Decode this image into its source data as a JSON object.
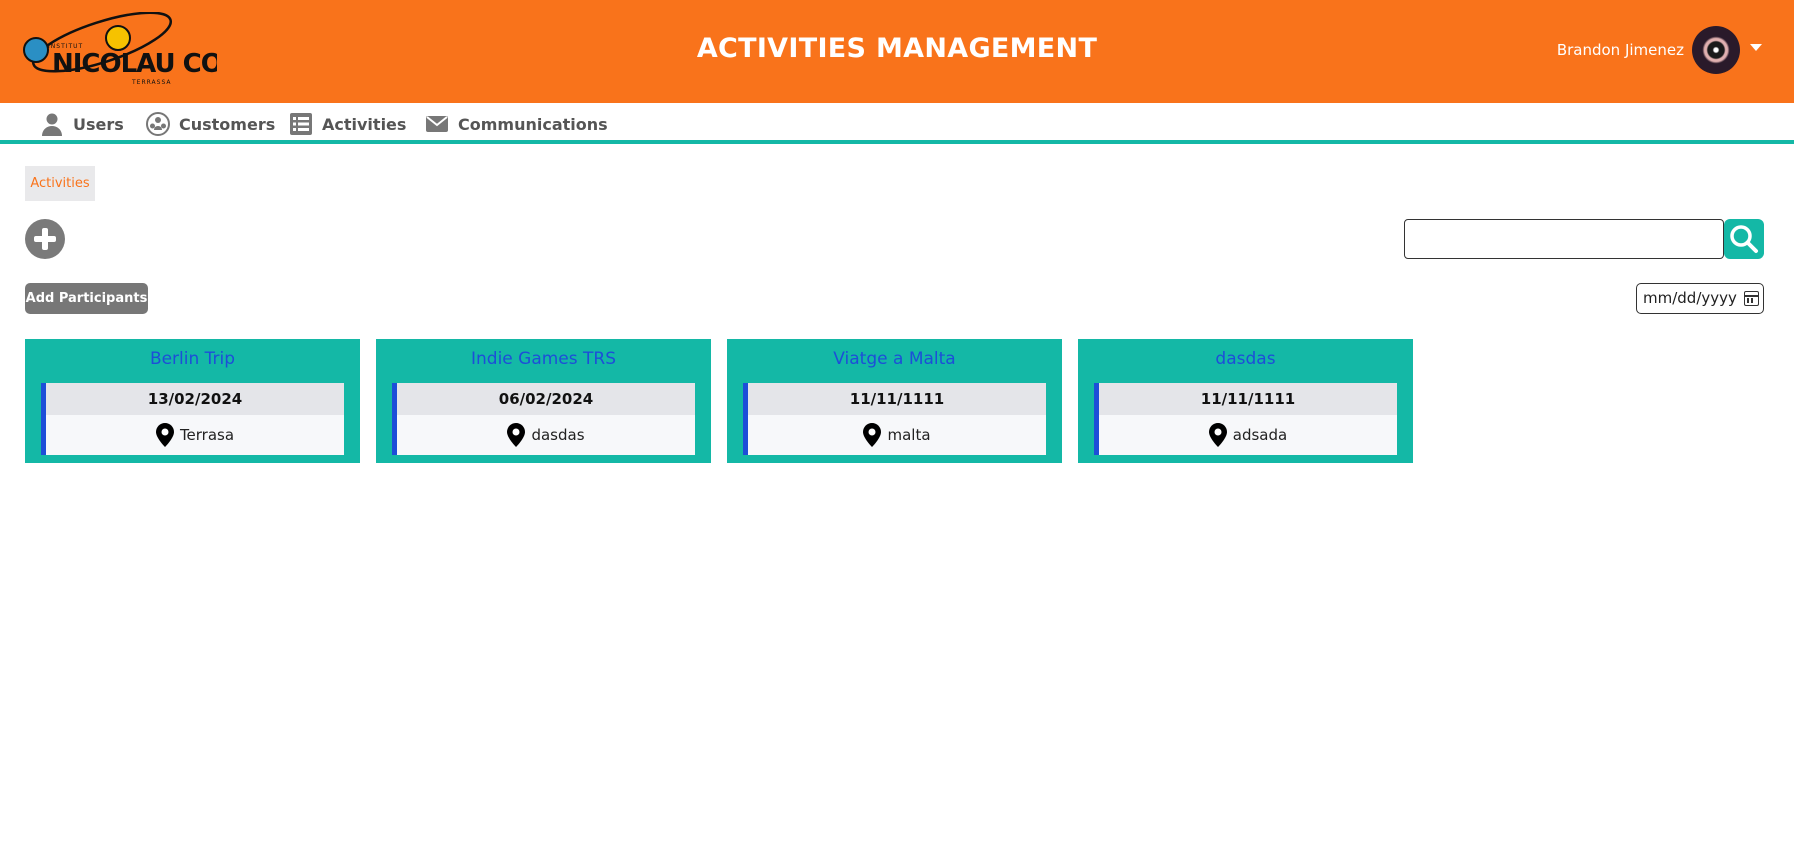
{
  "header": {
    "logo_text": "Institut Nicolau Copèrnic Terrassa",
    "title": "ACTIVITIES MANAGEMENT",
    "user_name": "Brandon Jimenez"
  },
  "nav": {
    "items": [
      {
        "label": "Users",
        "icon": "user-icon"
      },
      {
        "label": "Customers",
        "icon": "customers-icon"
      },
      {
        "label": "Activities",
        "icon": "list-icon"
      },
      {
        "label": "Communications",
        "icon": "envelope-icon"
      }
    ]
  },
  "breadcrumb": {
    "label": "Activities"
  },
  "toolbar": {
    "add_participants_label": "Add Participants",
    "search_placeholder": "",
    "search_value": "",
    "date_placeholder": "mm/dd/yyyy"
  },
  "colors": {
    "header_bg": "#f9731b",
    "accent": "#14b8a6",
    "card_title": "#1d4ed8"
  },
  "activities": [
    {
      "title": "Berlin Trip",
      "date": "13/02/2024",
      "location": "Terrasa"
    },
    {
      "title": "Indie Games TRS",
      "date": "06/02/2024",
      "location": "dasdas"
    },
    {
      "title": "Viatge a Malta",
      "date": "11/11/1111",
      "location": "malta"
    },
    {
      "title": "dasdas",
      "date": "11/11/1111",
      "location": "adsada"
    }
  ]
}
